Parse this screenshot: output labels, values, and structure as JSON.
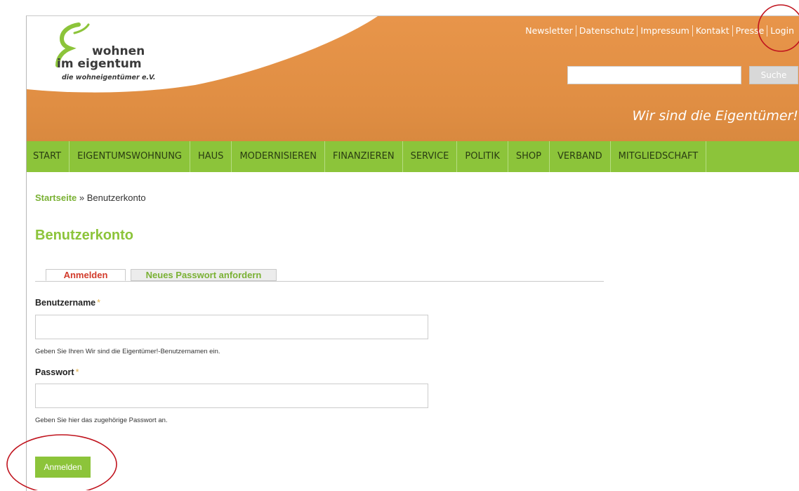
{
  "logo": {
    "line1": "wohnen",
    "line2": "im eigentum",
    "line3": "die wohneigentümer e.V."
  },
  "top_nav": [
    "Newsletter",
    "Datenschutz",
    "Impressum",
    "Kontakt",
    "Presse",
    "Login"
  ],
  "search": {
    "button_label": "Suche",
    "value": ""
  },
  "slogan": "Wir sind die Eigentümer!",
  "main_nav": [
    "START",
    "EIGENTUMSWOHNUNG",
    "HAUS",
    "MODERNISIEREN",
    "FINANZIEREN",
    "SERVICE",
    "POLITIK",
    "SHOP",
    "VERBAND",
    "MITGLIEDSCHAFT"
  ],
  "breadcrumb": {
    "home": "Startseite",
    "separator": "»",
    "current": "Benutzerkonto"
  },
  "page_title": "Benutzerkonto",
  "tabs": {
    "login": "Anmelden",
    "new_password": "Neues Passwort anfordern"
  },
  "form": {
    "username": {
      "label": "Benutzername",
      "required_mark": "*",
      "value": "",
      "hint": "Geben Sie Ihren Wir sind die Eigentümer!-Benutzernamen ein."
    },
    "password": {
      "label": "Passwort",
      "required_mark": "*",
      "value": "",
      "hint": "Geben Sie hier das zugehörige Passwort an."
    },
    "submit_label": "Anmelden"
  },
  "colors": {
    "header_orange": "#e08e43",
    "nav_green": "#8cc43a",
    "title_green": "#8cc43a",
    "active_tab_red": "#d23b2b",
    "annotation_red": "#c0141e"
  }
}
